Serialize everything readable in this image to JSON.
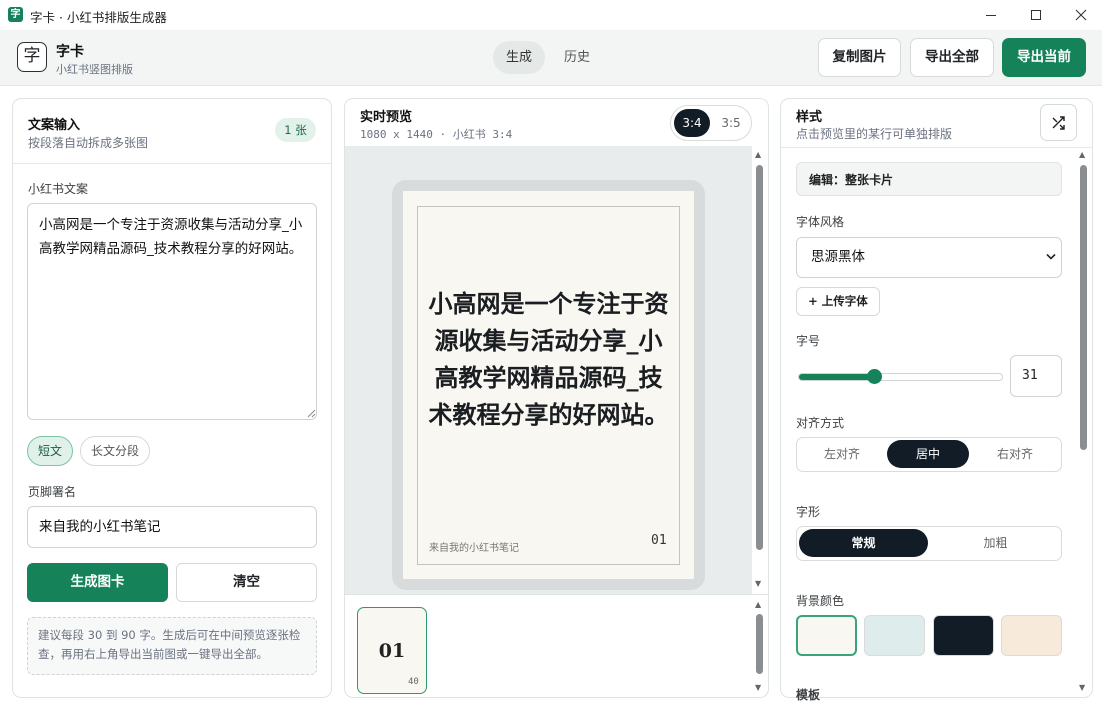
{
  "window": {
    "title": "字卡 · 小红书排版生成器",
    "app_icon": "字"
  },
  "header": {
    "logo_char": "字",
    "brand": "字卡",
    "brand_sub": "小红书竖图排版",
    "nav": [
      {
        "label": "生成",
        "active": true
      },
      {
        "label": "历史",
        "active": false
      }
    ],
    "actions": {
      "copy": "复制图片",
      "export_all": "导出全部",
      "export_current": "导出当前"
    }
  },
  "left": {
    "title": "文案输入",
    "subtitle": "按段落自动拆成多张图",
    "count_badge": "1 张",
    "copy_label": "小红书文案",
    "copy_text": "小高网是一个专注于资源收集与活动分享_小高教学网精品源码_技术教程分享的好网站。",
    "modes": [
      {
        "label": "短文",
        "active": true
      },
      {
        "label": "长文分段",
        "active": false
      }
    ],
    "footer_label": "页脚署名",
    "footer_value": "来自我的小红书笔记",
    "generate": "生成图卡",
    "clear": "清空",
    "tip": "建议每段 30 到 90 字。生成后可在中间预览逐张检查，再用右上角导出当前图或一键导出全部。"
  },
  "preview": {
    "title": "实时预览",
    "meta": "1080 x 1440 · 小红书 3:4",
    "ratios": [
      {
        "label": "3:4",
        "active": true
      },
      {
        "label": "3:5",
        "active": false
      }
    ],
    "card_text": "小高网是一个专注于资源收集与活动分享_小高教学网精品源码_技术教程分享的好网站。",
    "card_footer": "来自我的小红书笔记",
    "card_page": "01",
    "thumb_page": "01",
    "thumb_count": "40"
  },
  "style": {
    "title": "样式",
    "subtitle": "点击预览里的某行可单独排版",
    "shuffle_icon": "shuffle-icon",
    "edit_label": "编辑：整张卡片",
    "font_label": "字体风格",
    "font_value": "思源黑体",
    "upload_font": "+ 上传字体",
    "size_label": "字号",
    "size_value": "31",
    "size_fraction": 0.37,
    "align_label": "对齐方式",
    "align": [
      {
        "label": "左对齐",
        "active": false
      },
      {
        "label": "居中",
        "active": true
      },
      {
        "label": "右对齐",
        "active": false
      }
    ],
    "weight_label": "字形",
    "weight": [
      {
        "label": "常规",
        "active": true
      },
      {
        "label": "加粗",
        "active": false
      }
    ],
    "bg_label": "背景颜色",
    "bg_colors": [
      "#f9f7f1",
      "#dfecec",
      "#121c27",
      "#f8eadb"
    ],
    "template_label": "模板"
  },
  "colors": {
    "accent": "#15825a",
    "dark": "#111c27",
    "card_bg": "#f9f7f1"
  }
}
